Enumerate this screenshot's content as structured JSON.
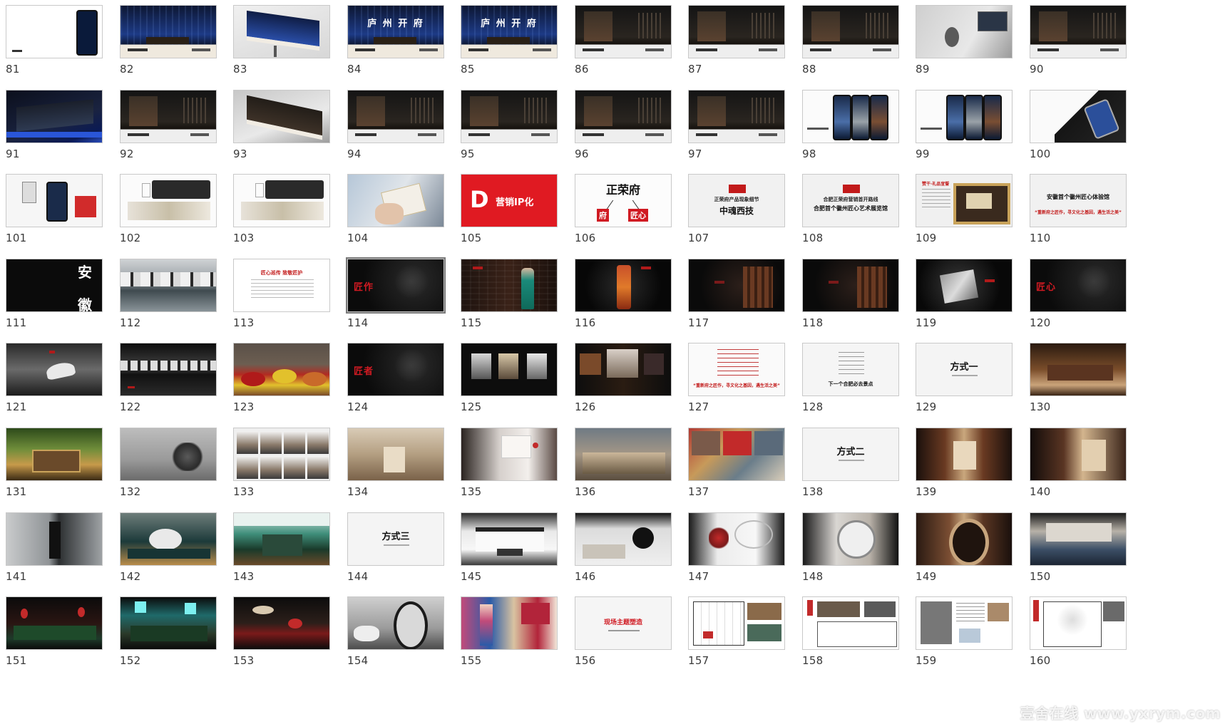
{
  "slides": [
    {
      "n": "81",
      "s": "white-phone"
    },
    {
      "n": "82",
      "s": "blue-banner"
    },
    {
      "n": "83",
      "s": "billboard-blue"
    },
    {
      "n": "84",
      "s": "blue-banner",
      "t": "庐 州 开 府"
    },
    {
      "n": "85",
      "s": "blue-banner",
      "t": "庐 州 开 府"
    },
    {
      "n": "86",
      "s": "dark-banner"
    },
    {
      "n": "87",
      "s": "dark-banner"
    },
    {
      "n": "88",
      "s": "dark-banner"
    },
    {
      "n": "89",
      "s": "gray-room"
    },
    {
      "n": "90",
      "s": "dark-banner"
    },
    {
      "n": "91",
      "s": "dark-blue-scene"
    },
    {
      "n": "92",
      "s": "dark-banner"
    },
    {
      "n": "93",
      "s": "billboard-dark"
    },
    {
      "n": "94",
      "s": "dark-banner"
    },
    {
      "n": "95",
      "s": "dark-banner"
    },
    {
      "n": "96",
      "s": "dark-banner"
    },
    {
      "n": "97",
      "s": "dark-banner"
    },
    {
      "n": "98",
      "s": "white-phones"
    },
    {
      "n": "99",
      "s": "white-phones"
    },
    {
      "n": "100",
      "s": "white-phone-dark"
    },
    {
      "n": "101",
      "s": "white-phone-red"
    },
    {
      "n": "102",
      "s": "white-ink"
    },
    {
      "n": "103",
      "s": "white-ink"
    },
    {
      "n": "104",
      "s": "white-hand"
    },
    {
      "n": "105",
      "s": "red-title",
      "t": "营销IP化",
      "big": "D"
    },
    {
      "n": "106",
      "s": "white-chart",
      "t": "正荣府",
      "a": "府",
      "b": "匠心"
    },
    {
      "n": "107",
      "s": "gray-text",
      "t": "中魂西技",
      "t2": "正荣府产品现象细节"
    },
    {
      "n": "108",
      "s": "gray-text",
      "t": "合肥首个徽州匠心艺术展览馆",
      "t2": "合肥正荣府营销首开路线"
    },
    {
      "n": "109",
      "s": "gray-frame",
      "t": "赞干·礼品宣誓"
    },
    {
      "n": "110",
      "s": "gray-text",
      "t": "安徽首个徽州匠心体验馆",
      "t2": "“重新府之匠作，寻文化之基因，遇生活之美”",
      "red2": true
    },
    {
      "n": "111",
      "s": "black-calli",
      "t": "安",
      "t3": "徽"
    },
    {
      "n": "112",
      "s": "village-water"
    },
    {
      "n": "113",
      "s": "white-doc",
      "t": "匠心巡传  致敬匠护"
    },
    {
      "n": "114",
      "s": "black-red",
      "t": "匠作",
      "sel": true
    },
    {
      "n": "115",
      "s": "brown-figure"
    },
    {
      "n": "116",
      "s": "black-object"
    },
    {
      "n": "117",
      "s": "black-panel"
    },
    {
      "n": "118",
      "s": "black-panel"
    },
    {
      "n": "119",
      "s": "black-object2"
    },
    {
      "n": "120",
      "s": "black-red",
      "t": "匠心"
    },
    {
      "n": "121",
      "s": "bw-river"
    },
    {
      "n": "122",
      "s": "night-village"
    },
    {
      "n": "123",
      "s": "colorful-bowls"
    },
    {
      "n": "124",
      "s": "black-red",
      "t": "匠者"
    },
    {
      "n": "125",
      "s": "black-portraits"
    },
    {
      "n": "126",
      "s": "black-photos"
    },
    {
      "n": "127",
      "s": "white-redtext",
      "t": "“重新府之匠作，寻文化之基因，遇生活之美”"
    },
    {
      "n": "128",
      "s": "white-list",
      "t": "下一个合肥必去景点"
    },
    {
      "n": "129",
      "s": "white-title",
      "t": "方式一"
    },
    {
      "n": "130",
      "s": "warm-interior"
    },
    {
      "n": "131",
      "s": "green-interior"
    },
    {
      "n": "132",
      "s": "gray-sculpture"
    },
    {
      "n": "133",
      "s": "sculpture-grid"
    },
    {
      "n": "134",
      "s": "beige-room"
    },
    {
      "n": "135",
      "s": "gallery-dark"
    },
    {
      "n": "136",
      "s": "sculpture-wide"
    },
    {
      "n": "137",
      "s": "colorful-collage"
    },
    {
      "n": "138",
      "s": "white-title",
      "t": "方式二"
    },
    {
      "n": "139",
      "s": "dark-gallery"
    },
    {
      "n": "140",
      "s": "dark-gallery2"
    },
    {
      "n": "141",
      "s": "gray-corridor"
    },
    {
      "n": "142",
      "s": "teal-room"
    },
    {
      "n": "143",
      "s": "teal-bright"
    },
    {
      "n": "144",
      "s": "white-title",
      "t": "方式三"
    },
    {
      "n": "145",
      "s": "white-space"
    },
    {
      "n": "146",
      "s": "white-moon"
    },
    {
      "n": "147",
      "s": "white-red-tree"
    },
    {
      "n": "148",
      "s": "dark-round"
    },
    {
      "n": "149",
      "s": "wood-round"
    },
    {
      "n": "150",
      "s": "blue-room"
    },
    {
      "n": "151",
      "s": "dark-red-lamps"
    },
    {
      "n": "152",
      "s": "teal-lights"
    },
    {
      "n": "153",
      "s": "red-lamps-dark"
    },
    {
      "n": "154",
      "s": "gray-circle"
    },
    {
      "n": "155",
      "s": "color-performers"
    },
    {
      "n": "156",
      "s": "white-redtitle",
      "t": "现场主题塑造"
    },
    {
      "n": "157",
      "s": "white-plan"
    },
    {
      "n": "158",
      "s": "white-plan2"
    },
    {
      "n": "159",
      "s": "white-doc2"
    },
    {
      "n": "160",
      "s": "white-plan3"
    }
  ],
  "watermark": "壹舍在线  www.yxrym.com"
}
